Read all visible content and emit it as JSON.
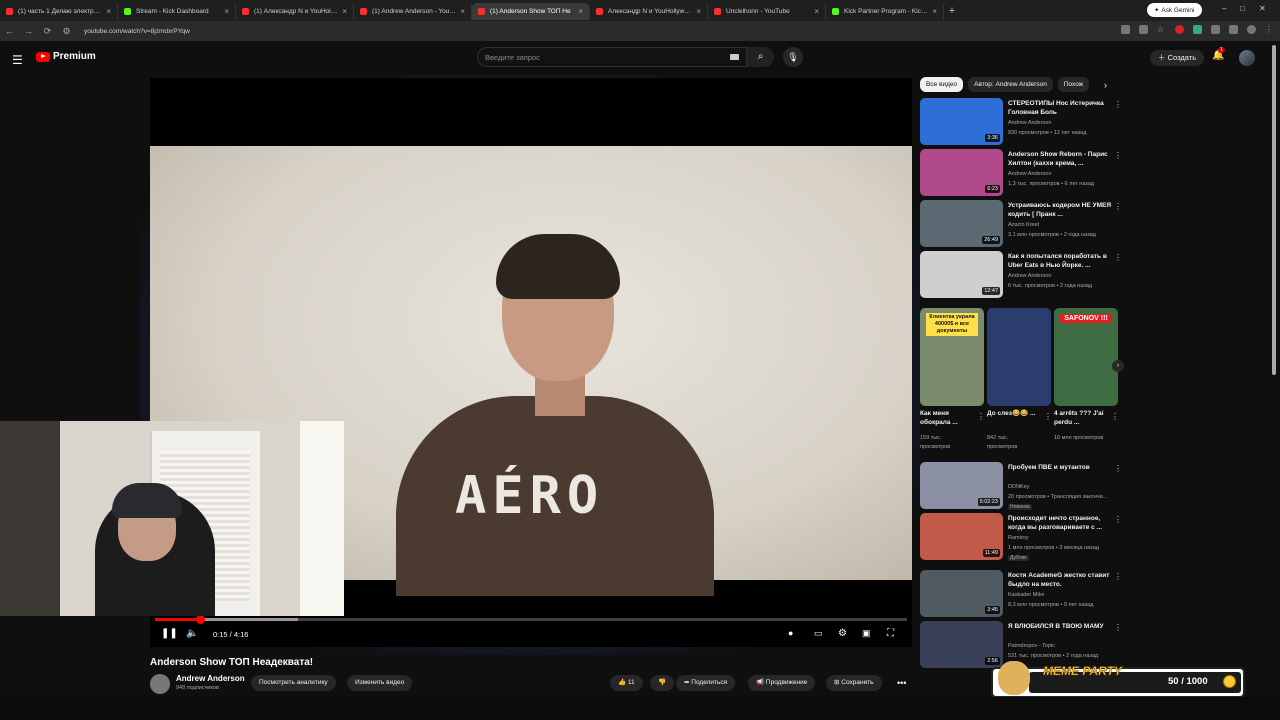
{
  "browser": {
    "tabs": [
      {
        "title": "(1) часть 1 Делаю электрику у",
        "color": "#ff2d2d"
      },
      {
        "title": "Stream - Kick Dashboard",
        "color": "#53fc18"
      },
      {
        "title": "(1) Александр N и YouHollyw",
        "color": "#ff2d2d"
      },
      {
        "title": "(1) Andrew Anderson - YouTub",
        "color": "#ff2d2d"
      },
      {
        "title": "(1) Anderson Show ТОП Не",
        "color": "#ff2d2d"
      },
      {
        "title": "Александр N и YouHollywood",
        "color": "#ff2d2d"
      },
      {
        "title": "Unclelhonn - YouTube",
        "color": "#ff2d2d"
      },
      {
        "title": "Kick Partner Program - Kick Da",
        "color": "#53fc18"
      }
    ],
    "ask_gemini": "Ask Gemini",
    "url": "youtube.com/watch?v=8jzmdxrPYqw"
  },
  "header": {
    "logo_text": "Premium",
    "search_placeholder": "Введите запрос",
    "create_label": "Создать",
    "notif_count": "1"
  },
  "video": {
    "time": "0:15 / 4:16",
    "progress": 0.06,
    "buffered": 0.19,
    "title": "Anderson Show ТОП Неадеквата!",
    "channel": "Andrew Anderson",
    "subscribers": "948 подписчиков",
    "shirt_text": "AÉRO",
    "likes": "11"
  },
  "actions": {
    "analytics": "Посмотреть аналитику",
    "edit": "Изменить видео",
    "share": "Поделиться",
    "promote": "Продвижение",
    "save": "Сохранить"
  },
  "chips": [
    "Все видео",
    "Автор: Andrew Anderson",
    "Похож"
  ],
  "recommendations": [
    {
      "title": "СТЕРЕОТИПЫ  Нос Истеричка Головная Боль",
      "channel": "Andrew Anderson",
      "meta": "830 просмотров • 12 лет назад",
      "duration": "3:36",
      "thumb_color": "#2d6fd6"
    },
    {
      "title": "Anderson Show Reborn - Парис Хилтон (каххи крема, ...",
      "channel": "Andrew Anderson",
      "meta": "1,3 тыс. просмотров • 6 лет назад",
      "duration": "6:23",
      "thumb_color": "#b04a8a"
    },
    {
      "title": "Устраиваюсь кодером НЕ УМЕЯ кодить [ Пранк ...",
      "channel": "Azazin Kreet",
      "meta": "3,1 млн просмотров • 2 года назад",
      "duration": "26:49",
      "thumb_color": "#5b6a72"
    },
    {
      "title": "Как я попытался поработать в Uber Eats в Нью Йорке. ...",
      "channel": "Andrew Anderson",
      "meta": "6 тыс. просмотров • 2 года назад",
      "duration": "12:47",
      "thumb_color": "#cfcfcf"
    }
  ],
  "shorts": [
    {
      "title": "Как меня обокрала ...",
      "views": "159 тыс. просмотров",
      "color": "#7a8b6d",
      "tag": "Клиентка украла 40000$ и все документы"
    },
    {
      "title": "До слез😂😂 ...",
      "views": "842 тыс. просмотров",
      "color": "#2b3d6e",
      "tag": ""
    },
    {
      "title": "4 arrêts ??? J'ai perdu ...",
      "views": "10 млн просмотров",
      "color": "#3f6b43",
      "tag": "SAFONOV !!!"
    }
  ],
  "recommendations2": [
    {
      "title": "Пробуем ПВЕ и мутантов",
      "channel": "DDNKey",
      "meta": "20 просмотров • Трансляция закончи...",
      "duration": "5:02:23",
      "tag": "Новинка",
      "thumb_color": "#8a8fa3"
    },
    {
      "title": "Происходит нечто странное, когда вы разговариваете с ...",
      "channel": "Ramiroy",
      "meta": "1 млн просмотров • 3 месяца назад",
      "duration": "11:49",
      "tag": "Дублик",
      "thumb_color": "#c25a4a"
    },
    {
      "title": "Костя AcademeG жестко ставит быдло на место.",
      "channel": "Kaskader Mike",
      "meta": "8,3 млн просмотров • 9 лет назад",
      "duration": "3:45",
      "tag": "",
      "thumb_color": "#4f5a63"
    },
    {
      "title": "Я ВЛЮБИЛСЯ В ТВОЮ МАМУ",
      "channel": "Paimdropov - Topic",
      "meta": "531 тыс. просмотров • 2 года назад",
      "duration": "2:56",
      "tag": "",
      "thumb_color": "#3a3f58"
    }
  ],
  "overlay": {
    "meme_text": "MEME PARTY",
    "counter": "50 / 1000"
  }
}
